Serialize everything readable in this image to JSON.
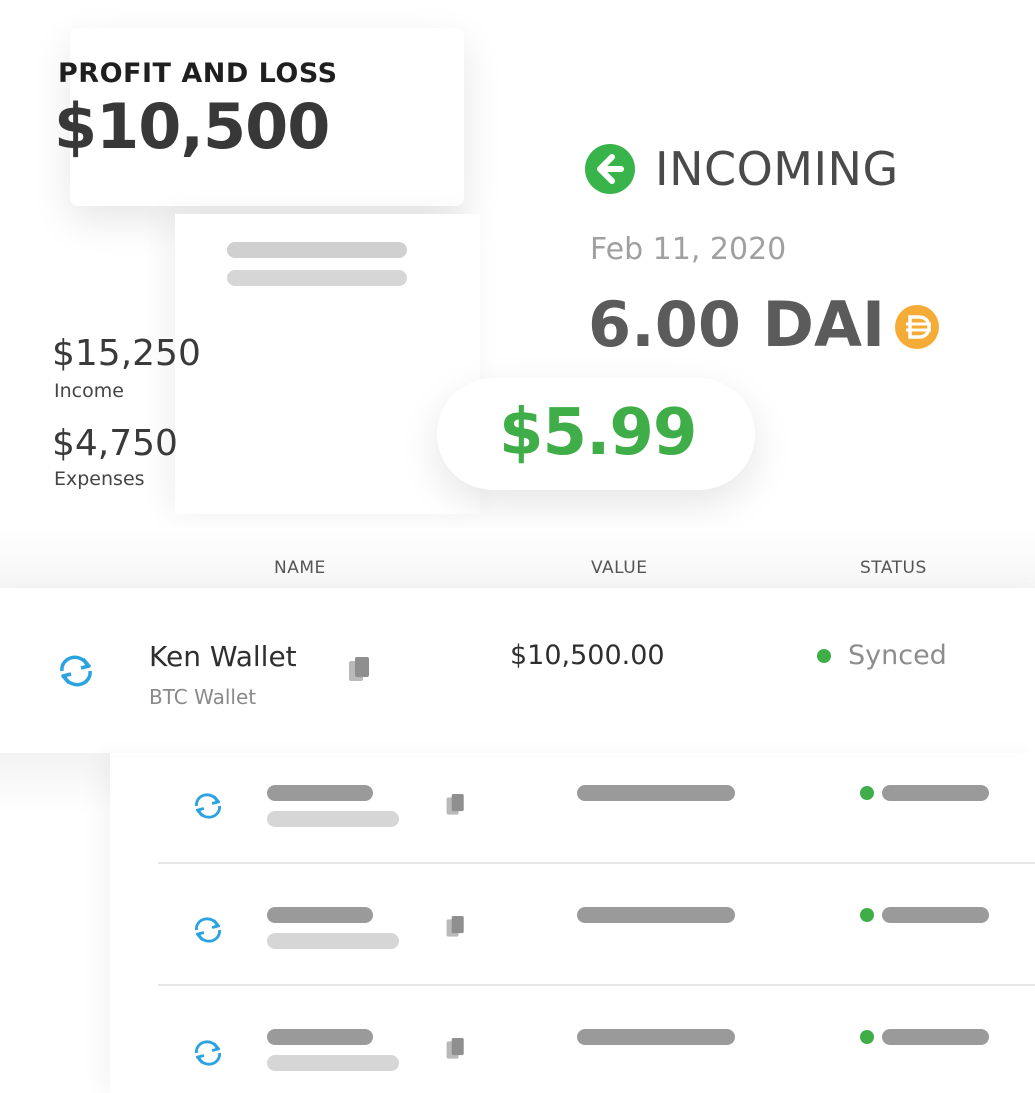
{
  "profit_loss": {
    "title": "PROFIT AND LOSS",
    "amount": "$10,500"
  },
  "summary": {
    "income_value": "$15,250",
    "income_label": "Income",
    "expenses_value": "$4,750",
    "expenses_label": "Expenses"
  },
  "incoming": {
    "title": "INCOMING",
    "icon": "arrow-left-circle-icon",
    "date": "Feb 11, 2020",
    "amount": "6.00 DAI",
    "token_icon": "dai-icon",
    "usd_value": "$5.99"
  },
  "table": {
    "columns": [
      "NAME",
      "VALUE",
      "STATUS"
    ],
    "rows": [
      {
        "name": "Ken Wallet",
        "type": "BTC Wallet",
        "value": "$10,500.00",
        "status": "Synced"
      }
    ]
  },
  "colors": {
    "accent_green": "#3fae49",
    "sync_blue": "#2aa3e0",
    "dai_orange": "#f5ac37"
  }
}
